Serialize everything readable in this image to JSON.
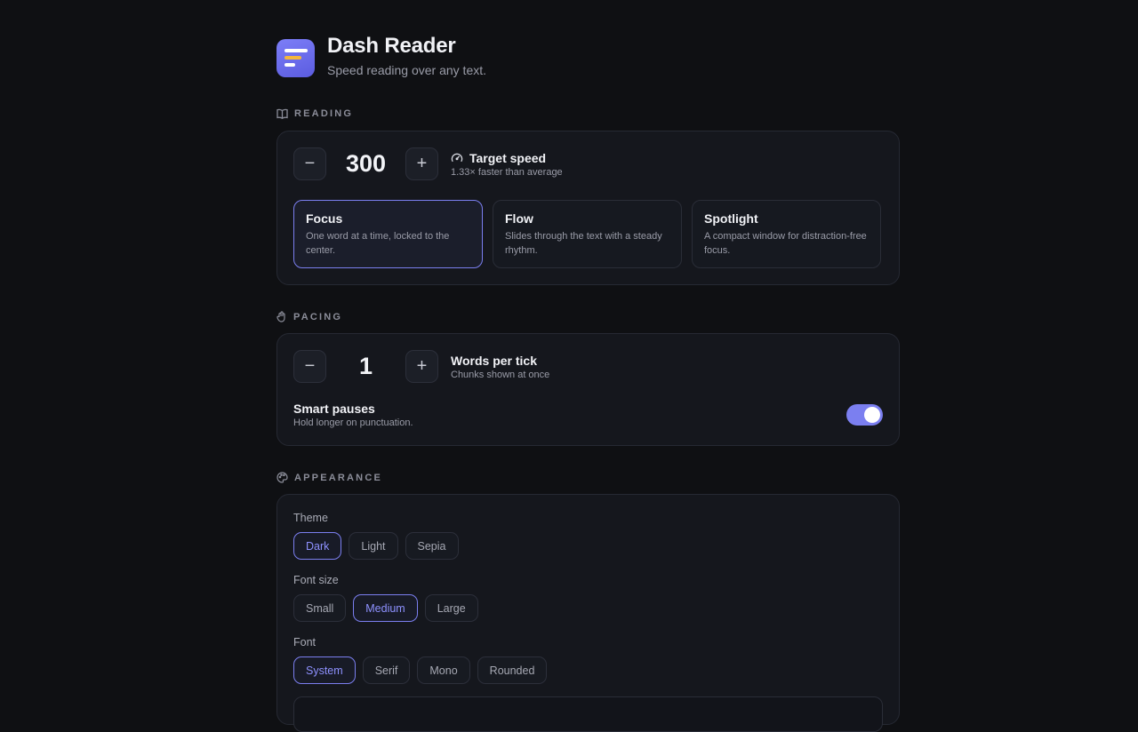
{
  "app": {
    "title": "Dash Reader",
    "subtitle": "Speed reading over any text.",
    "icon": "app-logo-icon",
    "accent": "#7b7ff0"
  },
  "reading": {
    "section_label": "READING",
    "section_icon": "book-icon",
    "speed": {
      "value": "300",
      "decrement_label": "−",
      "increment_label": "+",
      "title": "Target speed",
      "title_icon": "speedometer-icon",
      "subtitle": "1.33× faster than average"
    },
    "modes": [
      {
        "title": "Focus",
        "description": "One word at a time, locked to the center.",
        "selected": true
      },
      {
        "title": "Flow",
        "description": "Slides through the text with a steady rhythm.",
        "selected": false
      },
      {
        "title": "Spotlight",
        "description": "A compact window for distraction-free focus.",
        "selected": false
      }
    ]
  },
  "pacing": {
    "section_label": "PACING",
    "section_icon": "hand-icon",
    "words": {
      "value": "1",
      "decrement_label": "−",
      "increment_label": "+",
      "title": "Words per tick",
      "subtitle": "Chunks shown at once"
    },
    "smart_pauses": {
      "title": "Smart pauses",
      "subtitle": "Hold longer on punctuation.",
      "enabled": true
    }
  },
  "appearance": {
    "section_label": "APPEARANCE",
    "section_icon": "palette-icon",
    "theme": {
      "label": "Theme",
      "options": [
        "Dark",
        "Light",
        "Sepia"
      ],
      "selected": "Dark"
    },
    "font_size": {
      "label": "Font size",
      "options": [
        "Small",
        "Medium",
        "Large"
      ],
      "selected": "Medium"
    },
    "font": {
      "label": "Font",
      "options": [
        "System",
        "Serif",
        "Mono",
        "Rounded"
      ],
      "selected": "System"
    }
  }
}
